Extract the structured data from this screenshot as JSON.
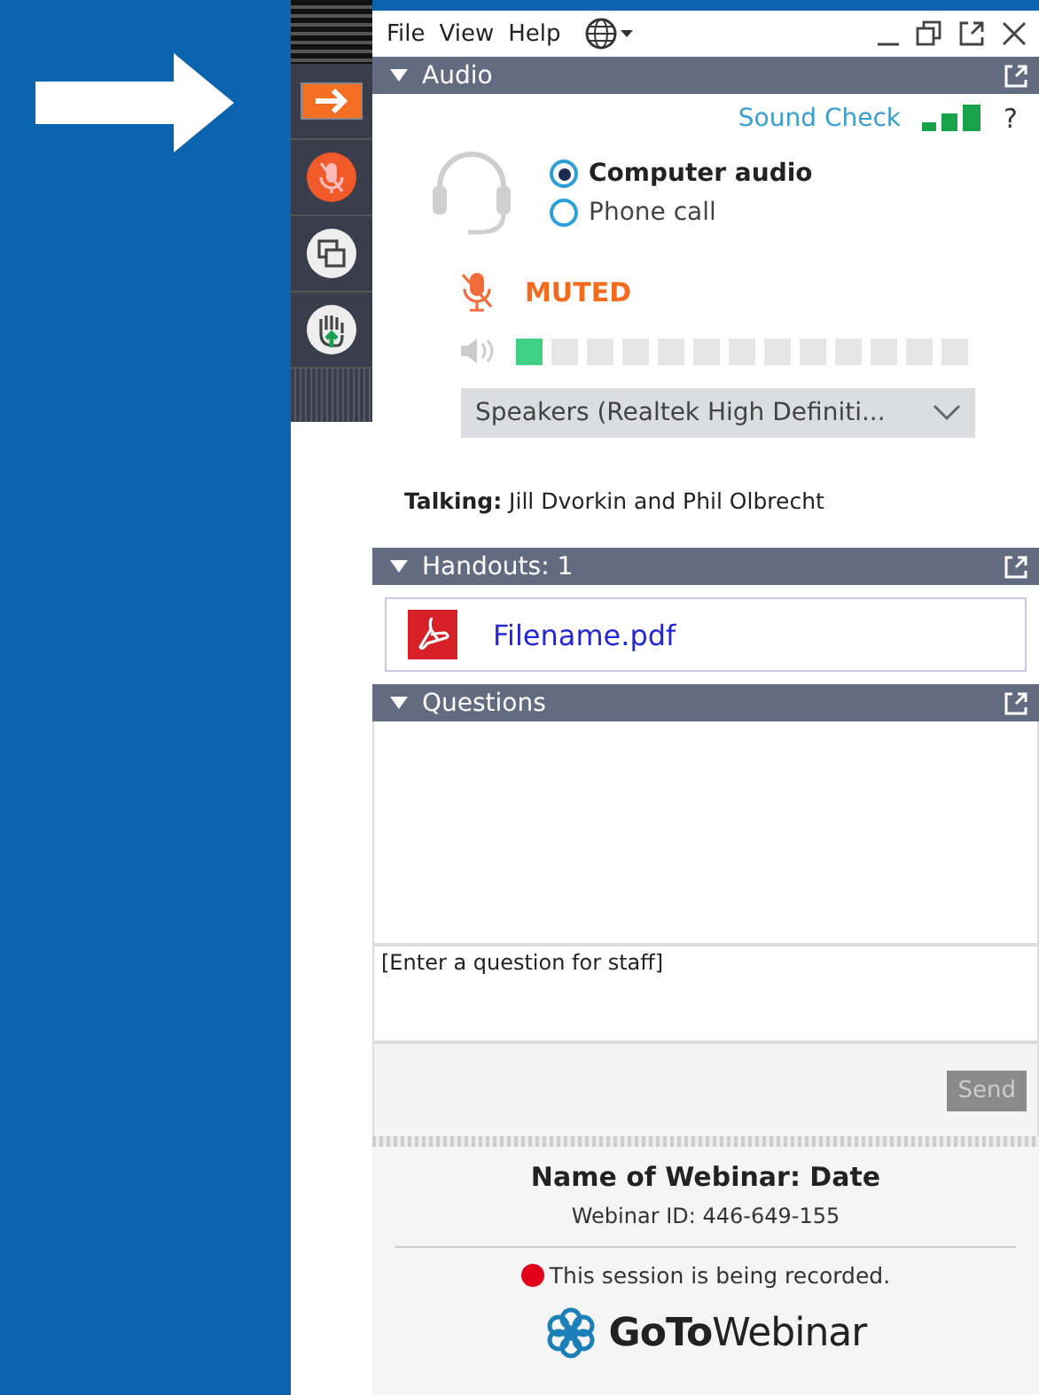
{
  "menu": [
    "File",
    "View",
    "Help"
  ],
  "audio": {
    "title": "Audio",
    "expanded": true,
    "sound_check": "Sound Check",
    "help": "?",
    "options": [
      {
        "label": "Computer audio",
        "selected": true
      },
      {
        "label": "Phone call",
        "selected": false
      }
    ],
    "muted": true,
    "muted_label": "MUTED",
    "level": 0.077,
    "speaker": "Speakers (Realtek High Definiti...",
    "talking": "**Talking:** Jill Dvorkin and Phil Olbrecht"
  },
  "handouts": {
    "title": "Handouts: 1",
    "expanded": true,
    "files": [
      "Filename.pdf"
    ]
  },
  "questions": {
    "title": "Questions",
    "expanded": true,
    "placeholder": "[Enter a question for staff]",
    "send": {
      "label": "Send",
      "disabled": true
    }
  },
  "footer": {
    "name": "Name of Webinar: Date",
    "webinar_id": "Webinar ID: 446-649-155",
    "recording": "This session is being recorded.",
    "logo": "**GoTo**Webinar"
  }
}
